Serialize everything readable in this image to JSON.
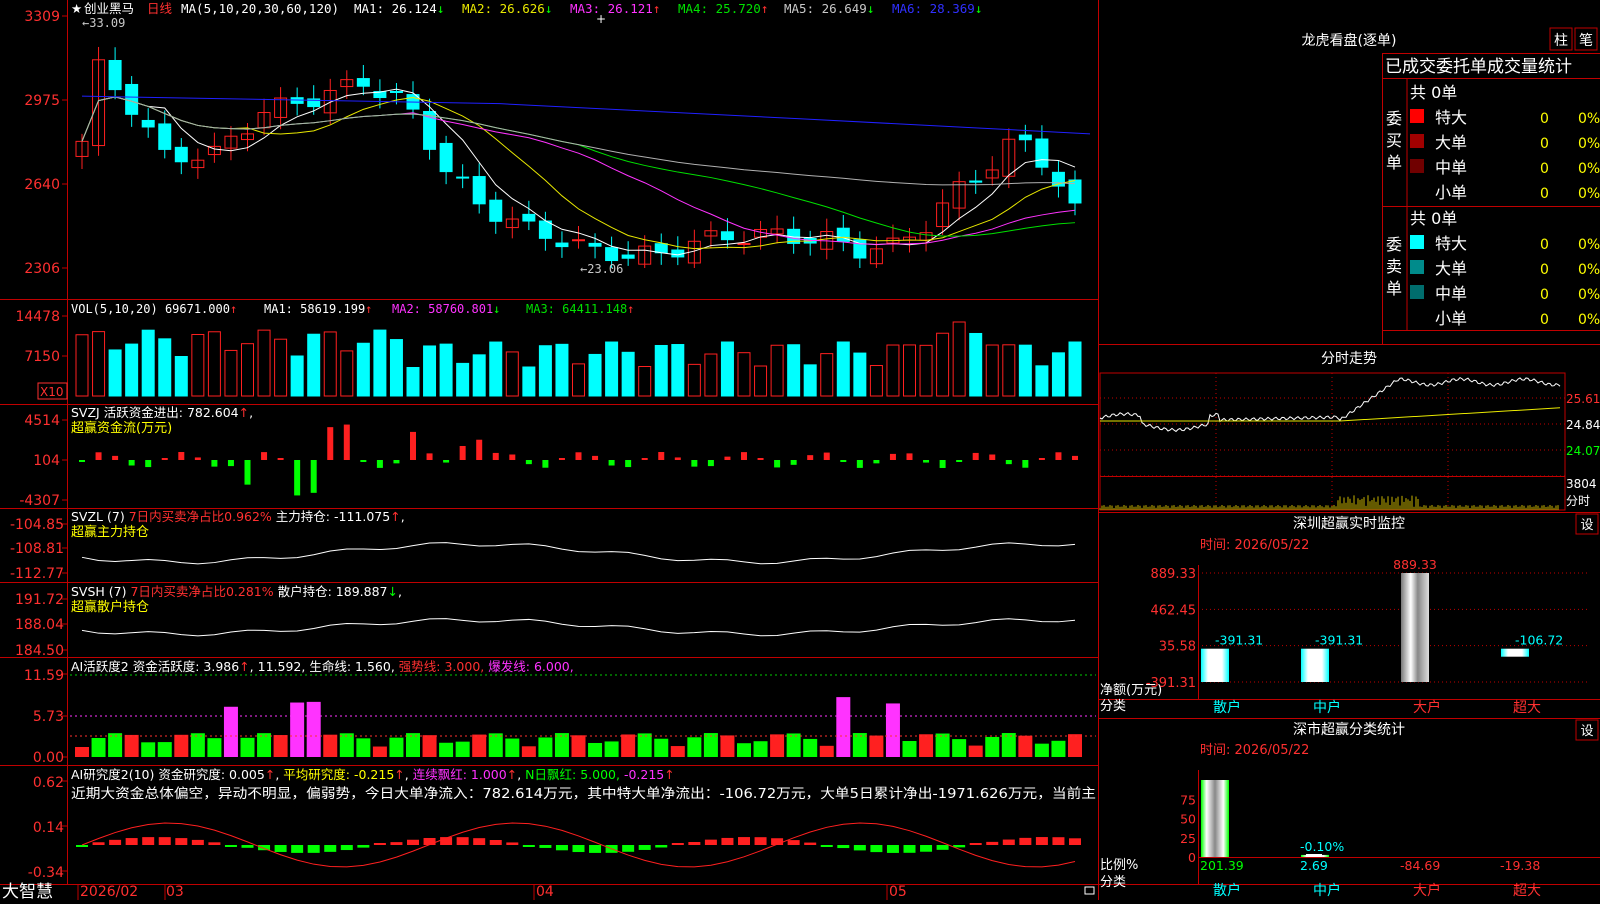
{
  "app": {
    "name": "大智慧"
  },
  "colors": {
    "up": "#ff2020",
    "down": "#00ffff",
    "axis": "#c00000",
    "bg": "#000000",
    "ma1": "#ffffff",
    "ma2": "#e8e800",
    "ma3": "#ff33ff",
    "ma4": "#00e000",
    "ma5": "#b0b0b0",
    "ma6": "#2020ff",
    "pos": "#ff2020",
    "neg": "#00ff00",
    "magenta": "#ff33ff",
    "yellow": "#ffff00"
  },
  "price_panel": {
    "stock": "创业黑马",
    "period": "日线",
    "ma_title": "MA(5,10,20,30,60,120)",
    "ma": [
      {
        "label": "MA1:",
        "value": "26.124",
        "arrow": "↓"
      },
      {
        "label": "MA2:",
        "value": "26.626",
        "arrow": "↓"
      },
      {
        "label": "MA3:",
        "value": "26.121",
        "arrow": "↑"
      },
      {
        "label": "MA4:",
        "value": "25.720",
        "arrow": "↑"
      },
      {
        "label": "MA5:",
        "value": "26.649",
        "arrow": "↓"
      },
      {
        "label": "MA6:",
        "value": "28.369",
        "arrow": "↓"
      }
    ],
    "high_mark": "33.09",
    "low_mark": "23.06",
    "yticks": [
      "3309",
      "2975",
      "2640",
      "2306"
    ]
  },
  "vol_panel": {
    "title": "VOL(5,10,20)",
    "value": "69671.000",
    "value_arrow": "↑",
    "ma": [
      {
        "label": "MA1:",
        "value": "58619.199",
        "arrow": "↑"
      },
      {
        "label": "MA2:",
        "value": "58760.801",
        "arrow": "↓"
      },
      {
        "label": "MA3:",
        "value": "64411.148",
        "arrow": "↑"
      }
    ],
    "yticks": [
      "14478",
      "7150"
    ],
    "unit": "X10"
  },
  "svzj_panel": {
    "title": "SVZJ",
    "label": "活跃资金进出:",
    "value": "782.604",
    "arrow": "↑",
    "subtitle": "超赢资金流(万元)",
    "yticks": [
      "4514",
      "104",
      "-4307"
    ]
  },
  "svzl_panel": {
    "title": "SVZL (7)",
    "pct_label": "7日内买卖净占比0.962%",
    "label": "主力持仓:",
    "value": "-111.075",
    "arrow": "↑",
    "subtitle": "超赢主力持仓",
    "yticks": [
      "-104.85",
      "-108.81",
      "-112.77"
    ]
  },
  "svsh_panel": {
    "title": "SVSH (7)",
    "pct_label": "7日内买卖净占比0.281%",
    "label": "散户持仓:",
    "value": "189.887",
    "arrow": "↓",
    "subtitle": "超赢散户持仓",
    "yticks": [
      "191.72",
      "188.04",
      "184.50"
    ]
  },
  "ai_active_panel": {
    "title": "AI活跃度2",
    "label1": "资金活跃度:",
    "value1": "3.986",
    "arrow1": "↑",
    "value2": "11.592,",
    "label3": "生命线:",
    "value3": "1.560,",
    "label4": "强势线:",
    "value4": "3.000,",
    "label5": "爆发线:",
    "value5": "6.000,",
    "yticks": [
      "11.59",
      "5.73",
      "0.00"
    ]
  },
  "ai_research_panel": {
    "title": "AI研究度2(10)",
    "label1": "资金研究度:",
    "value1": "0.005",
    "arrow1": "↑",
    "label2": "平均研究度:",
    "value2": "-0.215",
    "arrow2": "↑",
    "label3": "连续飘红:",
    "value3": "1.000",
    "arrow3": "↑",
    "label4": "N日飘红:",
    "value4": "5.000,",
    "value5": "-0.215",
    "arrow5": "↑",
    "comment": "近期大资金总体偏空，异动不明显，偏弱势，今日大单净流入：782.614万元，其中特大单净流出：-106.72万元，大单5日累计净出-1971.626万元，当前主",
    "yticks": [
      "0.62",
      "0.14",
      "-0.34"
    ]
  },
  "xaxis": {
    "labels": [
      "2026/02",
      "03",
      "04",
      "05"
    ]
  },
  "right": {
    "dragon_title": "龙虎看盘(逐单)",
    "tab1": "柱",
    "tab2": "笔",
    "stats_title": "已成交委托单成交量统计",
    "buy": {
      "label": "委买单",
      "total": "共 0单",
      "rows": [
        {
          "name": "特大",
          "count": "0",
          "pct": "0%",
          "color": "#ff0000"
        },
        {
          "name": "大单",
          "count": "0",
          "pct": "0%",
          "color": "#a00000"
        },
        {
          "name": "中单",
          "count": "0",
          "pct": "0%",
          "color": "#700000"
        },
        {
          "name": "小单",
          "count": "0",
          "pct": "0%",
          "color": ""
        }
      ]
    },
    "sell": {
      "label": "委卖单",
      "total": "共 0单",
      "rows": [
        {
          "name": "特大",
          "count": "0",
          "pct": "0%",
          "color": "#00ffff"
        },
        {
          "name": "大单",
          "count": "0",
          "pct": "0%",
          "color": "#008b8b"
        },
        {
          "name": "中单",
          "count": "0",
          "pct": "0%",
          "color": "#006d6d"
        },
        {
          "name": "小单",
          "count": "0",
          "pct": "0%",
          "color": ""
        }
      ]
    },
    "intraday_title": "分时走势",
    "intraday_yticks": [
      "25.61",
      "24.84",
      "24.07"
    ],
    "intraday_vol": "3804",
    "intraday_vol_label": "分时",
    "monitor_title": "深圳超赢实时监控",
    "settings": "设",
    "monitor_time": "时间: 2026/05/22",
    "monitor_yticks": [
      "889.33",
      "462.45",
      "35.58",
      "-391.31"
    ],
    "monitor_ylabel": "净额(万元)",
    "monitor_xlabel": "分类",
    "monitor_categories": [
      "散户",
      "中户",
      "大户",
      "超大"
    ],
    "monitor_values": [
      "-391.31",
      "-391.31",
      "889.33",
      "-106.72"
    ],
    "class_title": "深市超赢分类统计",
    "class_time": "时间: 2026/05/22",
    "class_yticks": [
      "75",
      "50",
      "25",
      "0"
    ],
    "class_ylabel": "比例%",
    "class_xlabel": "分类",
    "class_categories": [
      "散户",
      "中户",
      "大户",
      "超大"
    ],
    "class_values": [
      "201.39",
      "2.69",
      "-84.69",
      "-19.38"
    ],
    "class_small_label": "-0.10%"
  }
}
